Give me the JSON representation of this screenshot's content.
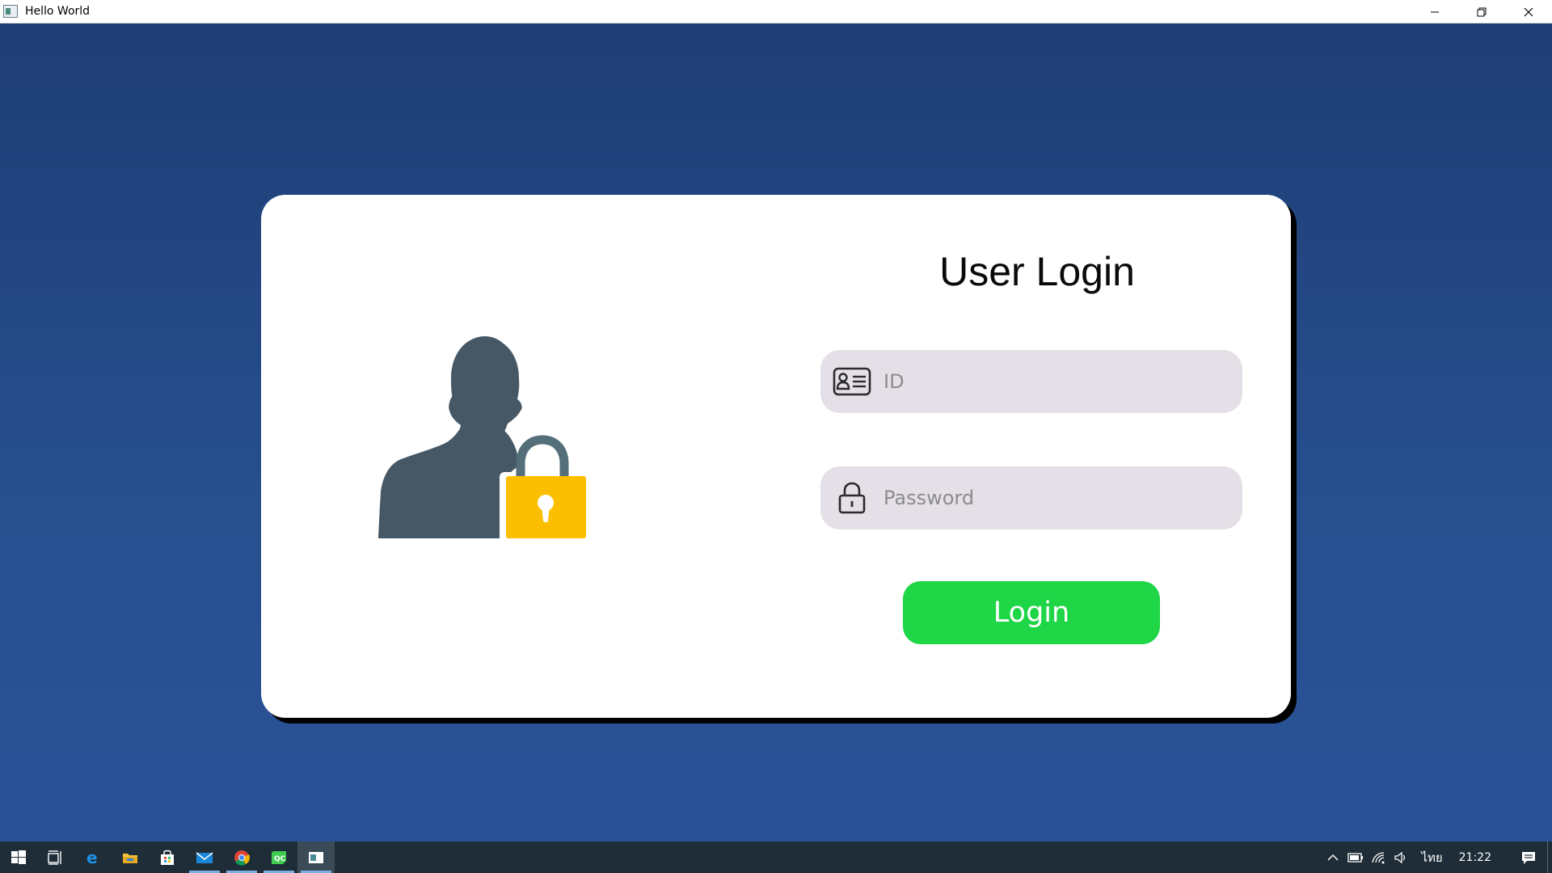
{
  "window": {
    "title": "Hello World",
    "controls": [
      "minimize-icon",
      "restore-icon",
      "close-icon"
    ]
  },
  "login": {
    "title": "User Login",
    "id_field": {
      "placeholder": "ID",
      "value": "",
      "icon": "id-card-icon"
    },
    "password_field": {
      "placeholder": "Password",
      "value": "",
      "icon": "lock-icon"
    },
    "login_button": "Login",
    "illustration": "user-lock-icon"
  },
  "colors": {
    "background": "#27508f",
    "card": "#ffffff",
    "field": "#e5e0e7",
    "button": "#1ed646",
    "silhouette": "#465866",
    "padlock": "#fcbf00"
  },
  "taskbar": {
    "apps": [
      "windows-start-icon",
      "task-view-icon",
      "edge-icon",
      "file-explorer-icon",
      "store-icon",
      "mail-icon",
      "chrome-icon",
      "qt-creator-icon",
      "hello-world-app-icon"
    ],
    "tray": {
      "icons": [
        "chevron-up-icon",
        "battery-icon",
        "wifi-icon",
        "volume-icon"
      ],
      "language": "ไทย",
      "time": "21:22"
    }
  }
}
